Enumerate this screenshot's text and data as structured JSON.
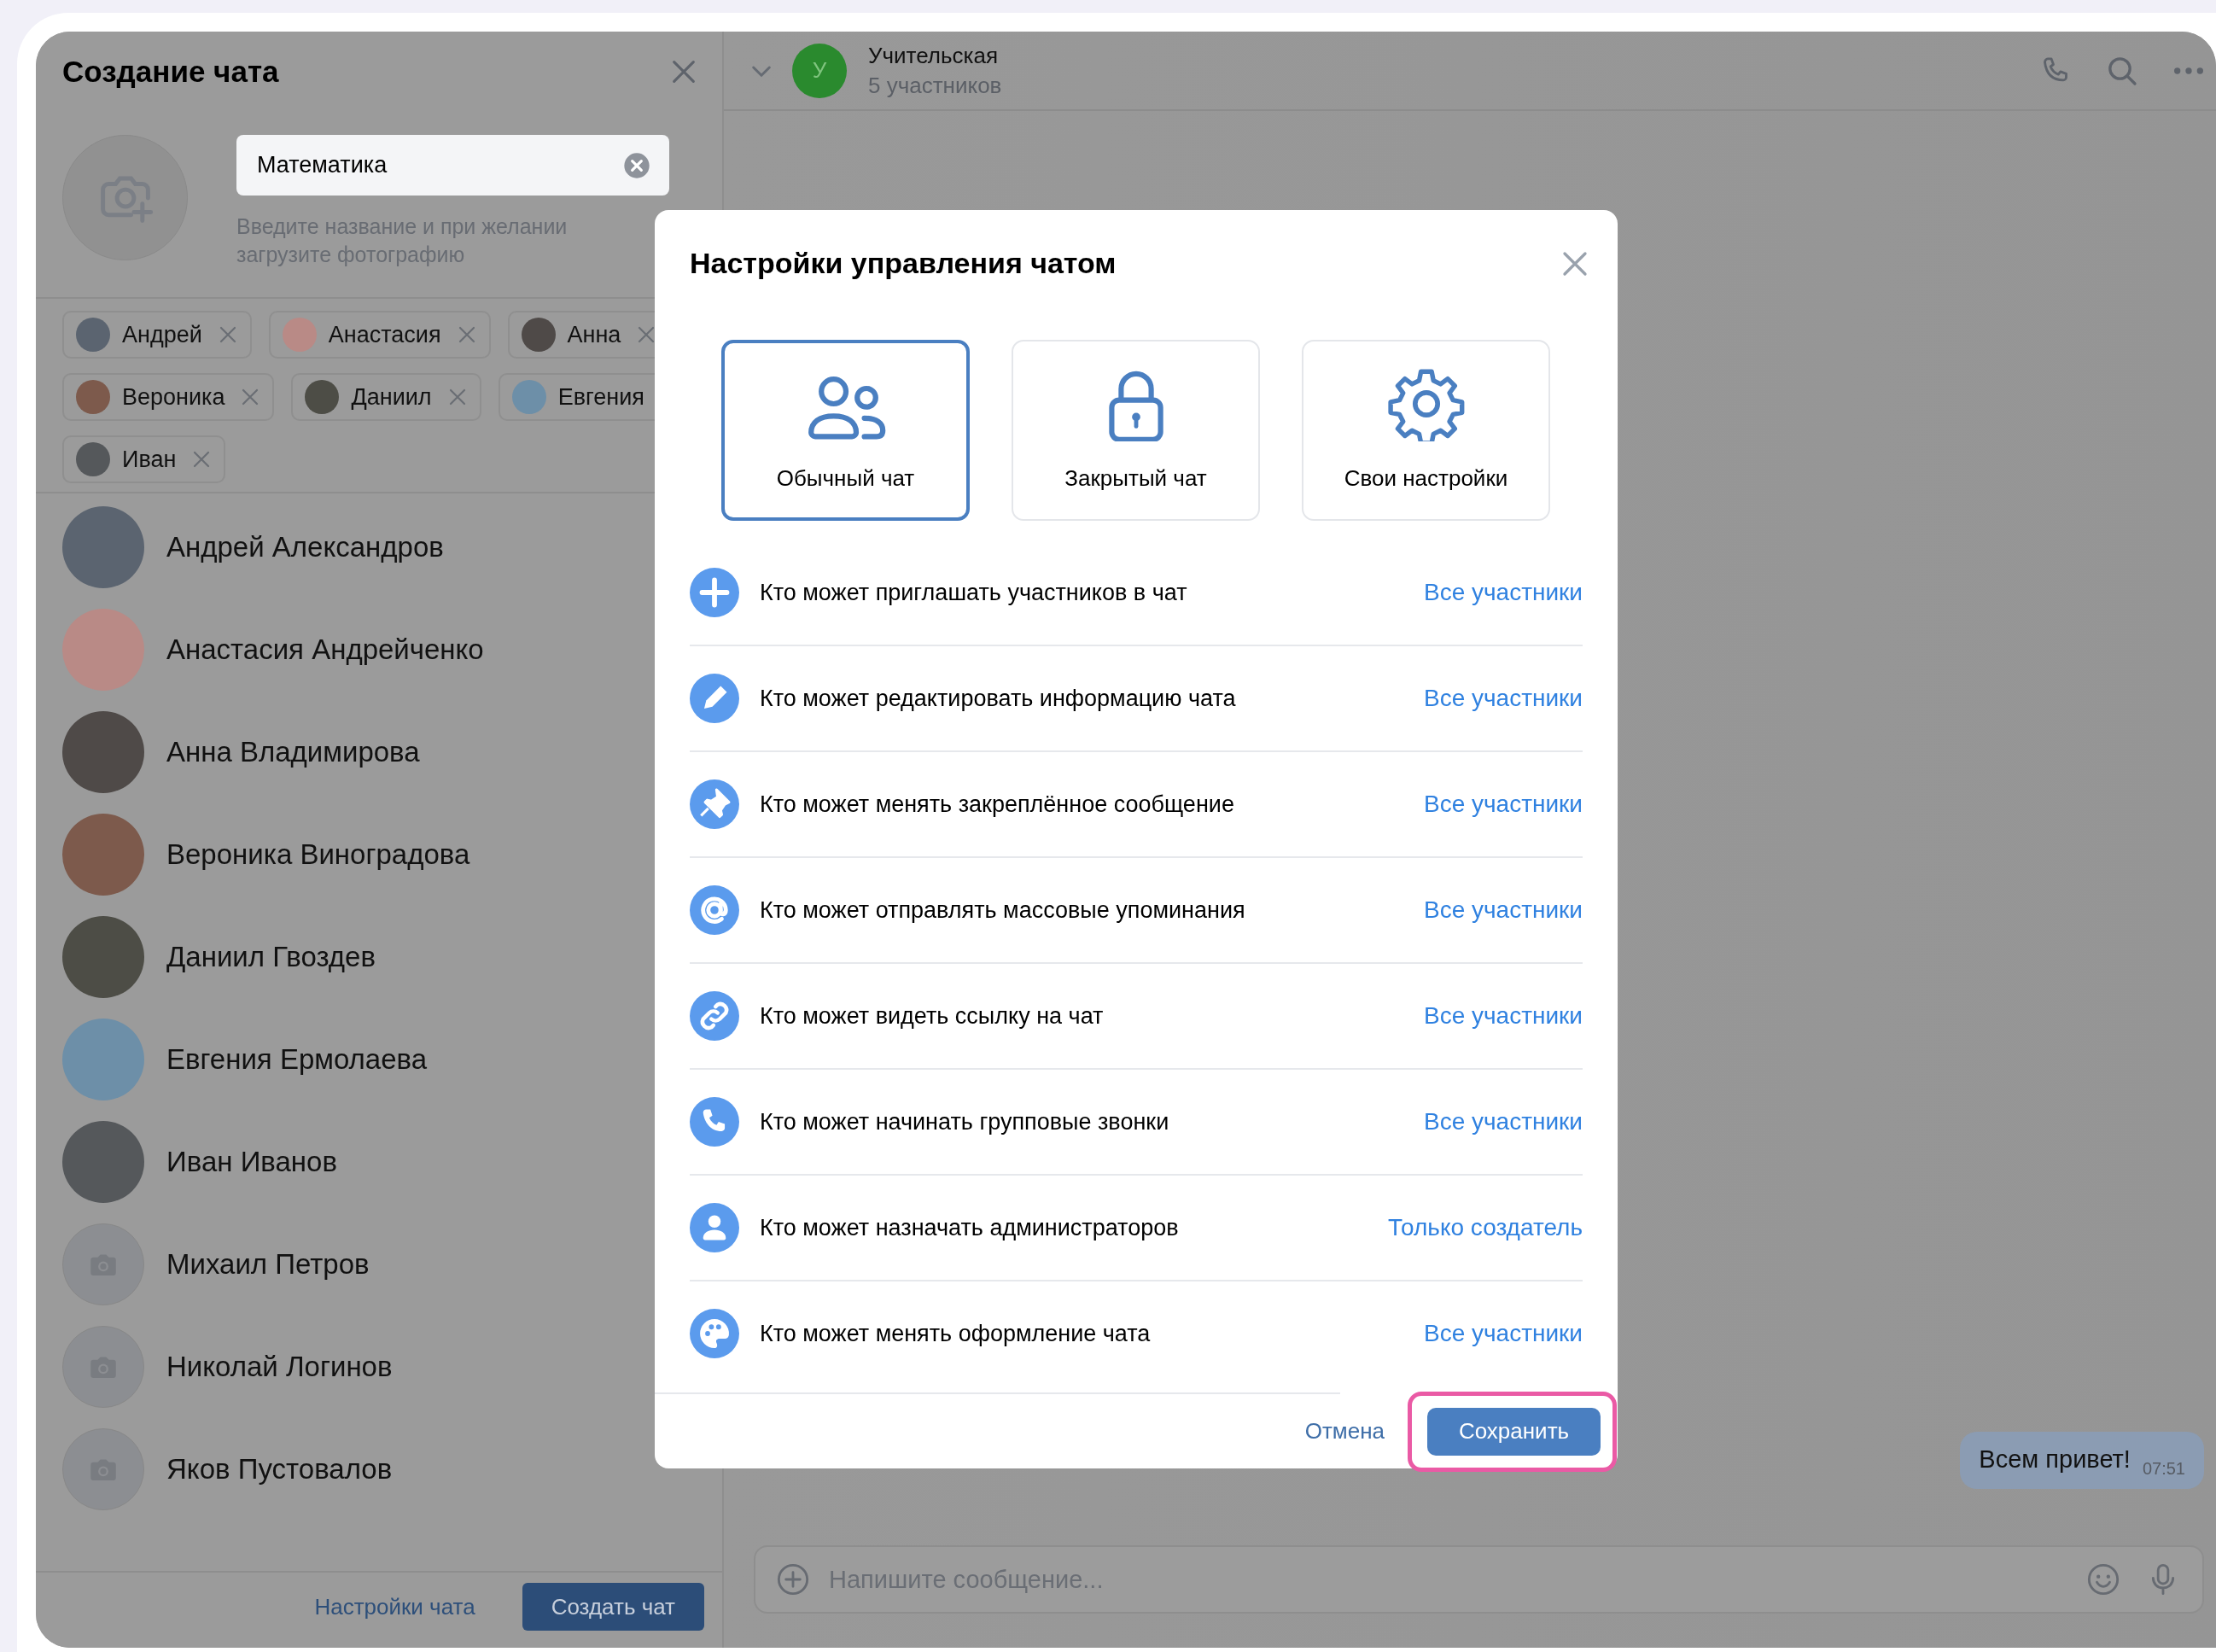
{
  "create_chat": {
    "title": "Создание чата",
    "name_field": {
      "value": "Математика"
    },
    "hint": "Введите название и при желании загрузите фотографию",
    "chips": [
      {
        "label": "Андрей",
        "removable": true
      },
      {
        "label": "Анастасия",
        "removable": true
      },
      {
        "label": "Анна",
        "removable": true
      },
      {
        "label": "Вероника",
        "removable": true
      },
      {
        "label": "Даниил",
        "removable": true
      },
      {
        "label": "Евгения",
        "removable": false
      },
      {
        "label": "Иван",
        "removable": true
      }
    ],
    "contacts": [
      {
        "name": "Андрей Александров",
        "kind": "photo"
      },
      {
        "name": "Анастасия Андрейченко",
        "kind": "photo"
      },
      {
        "name": "Анна Владимирова",
        "kind": "photo"
      },
      {
        "name": "Вероника Виноградова",
        "kind": "photo"
      },
      {
        "name": "Даниил Гвоздев",
        "kind": "photo"
      },
      {
        "name": "Евгения Ермолаева",
        "kind": "photo"
      },
      {
        "name": "Иван Иванов",
        "kind": "photo"
      },
      {
        "name": "Михаил Петров",
        "kind": "no_photo"
      },
      {
        "name": "Николай Логинов",
        "kind": "no_photo"
      },
      {
        "name": "Яков Пустовалов",
        "kind": "no_photo"
      }
    ],
    "settings_link": "Настройки чата",
    "create_button": "Создать чат"
  },
  "chat": {
    "avatar_letter": "У",
    "title": "Учительская",
    "subtitle": "5 участников",
    "messages": [
      {
        "text": "Всем привет!",
        "time": "07:51"
      }
    ],
    "composer": {
      "placeholder": "Напишите сообщение..."
    }
  },
  "modal": {
    "title": "Настройки управления чатом",
    "presets": [
      {
        "label": "Обычный чат",
        "selected": true
      },
      {
        "label": "Закрытый чат",
        "selected": false
      },
      {
        "label": "Свои настройки",
        "selected": false
      }
    ],
    "permissions": [
      {
        "label": "Кто может приглашать участников в чат",
        "value": "Все участники"
      },
      {
        "label": "Кто может редактировать информацию чата",
        "value": "Все участники"
      },
      {
        "label": "Кто может менять закреплённое сообщение",
        "value": "Все участники"
      },
      {
        "label": "Кто может отправлять массовые упоминания",
        "value": "Все участники"
      },
      {
        "label": "Кто может видеть ссылку на чат",
        "value": "Все участники"
      },
      {
        "label": "Кто может начинать групповые звонки",
        "value": "Все участники"
      },
      {
        "label": "Кто может назначать администраторов",
        "value": "Только создатель"
      },
      {
        "label": "Кто может менять оформление чата",
        "value": "Все участники"
      }
    ],
    "cancel": "Отмена",
    "save": "Сохранить",
    "save_highlighted": true
  }
}
